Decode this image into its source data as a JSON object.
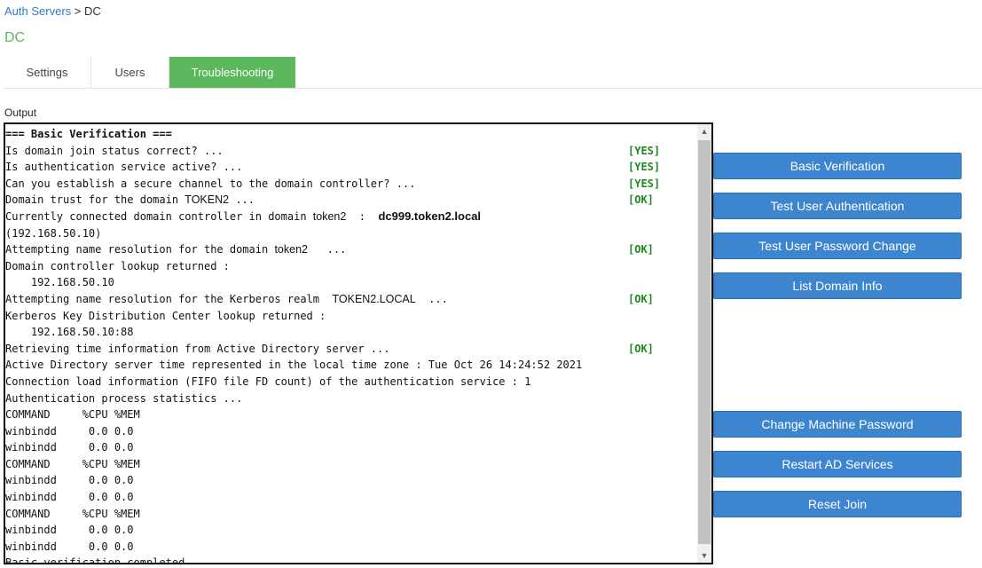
{
  "breadcrumb": {
    "parent": "Auth Servers",
    "separator": " > ",
    "current": "DC"
  },
  "page_title": "DC",
  "tabs": [
    {
      "label": "Settings"
    },
    {
      "label": "Users"
    },
    {
      "label": "Troubleshooting"
    }
  ],
  "output": {
    "label": "Output",
    "lines": {
      "l0": "=== Basic Verification ===",
      "l1": "Is domain join status correct? ...",
      "l1s": "[YES]",
      "l2": "Is authentication service active? ...",
      "l2s": "[YES]",
      "l3": "Can you establish a secure channel to the domain controller? ...",
      "l3s": "[YES]",
      "l4a": "Domain trust for the domain ",
      "l4b": "TOKEN2",
      "l4c": " ...",
      "l4s": "[OK]",
      "l5a": "Currently connected domain controller in domain ",
      "l5b": "token2",
      "l5c": "  :  ",
      "l5d": "dc999.token2.local",
      "l6": "(192.168.50.10)",
      "l7a": "Attempting name resolution for the domain ",
      "l7b": "token2",
      "l7c": "   ...",
      "l7s": "[OK]",
      "l8": "Domain controller lookup returned :",
      "l9": "    192.168.50.10",
      "l10a": "Attempting name resolution for the Kerberos realm  ",
      "l10b": "TOKEN2.LOCAL",
      "l10c": "  ...",
      "l10s": "[OK]",
      "l11": "Kerberos Key Distribution Center lookup returned :",
      "l12": "    192.168.50.10:88",
      "l13": "Retrieving time information from Active Directory server ...",
      "l13s": "[OK]",
      "l14": "Active Directory server time represented in the local time zone : Tue Oct 26 14:24:52 2021",
      "l15": "Connection load information (FIFO file FD count) of the authentication service : 1",
      "l16": "Authentication process statistics ...",
      "l17": "COMMAND     %CPU %MEM",
      "l18": "winbindd     0.0 0.0",
      "l19": "winbindd     0.0 0.0",
      "l20": "COMMAND     %CPU %MEM",
      "l21": "winbindd     0.0 0.0",
      "l22": "winbindd     0.0 0.0",
      "l23": "COMMAND     %CPU %MEM",
      "l24": "winbindd     0.0 0.0",
      "l25": "winbindd     0.0 0.0",
      "l26": "Basic verification completed."
    }
  },
  "buttons": {
    "basic_verification": "Basic Verification",
    "test_user_authentication": "Test User Authentication",
    "test_user_password_change": "Test User Password Change",
    "list_domain_info": "List Domain Info",
    "change_machine_password": "Change Machine Password",
    "restart_ad_services": "Restart AD Services",
    "reset_join": "Reset Join"
  },
  "icons": {
    "scroll_up": "▲",
    "scroll_down": "▼"
  },
  "colors": {
    "accent_green": "#5cb85c",
    "button_blue": "#3d86cf",
    "status_green": "#1e8a1e",
    "link_blue": "#2f77c7"
  }
}
